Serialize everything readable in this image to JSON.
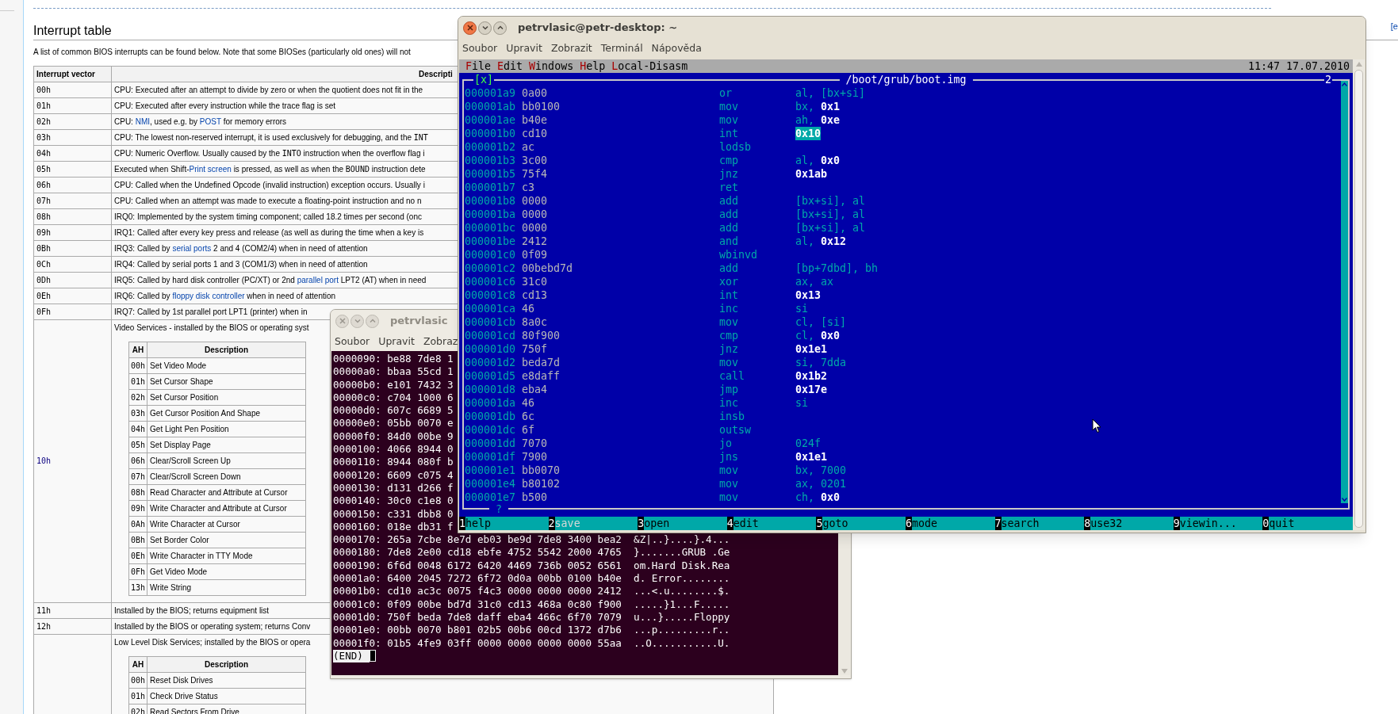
{
  "wiki": {
    "heading": "Interrupt table",
    "edit_link": "[e",
    "intro": "A list of common BIOS interrupts can be found below. Note that some BIOSes (particularly old ones) will not",
    "table": {
      "columns": [
        "Interrupt vector",
        "Descripti"
      ],
      "rows": [
        {
          "vector": {
            "kind": "text",
            "text": "00h"
          },
          "description": [
            {
              "kind": "text",
              "text": "CPU: Executed after an attempt to divide by zero or when the quotient does not fit in the"
            }
          ]
        },
        {
          "vector": {
            "kind": "text",
            "text": "01h"
          },
          "description": [
            {
              "kind": "text",
              "text": "CPU: Executed after every instruction while the trace flag is set"
            }
          ]
        },
        {
          "vector": {
            "kind": "text",
            "text": "02h"
          },
          "description": [
            {
              "kind": "text",
              "text": "CPU: "
            },
            {
              "kind": "link",
              "text": "NMI"
            },
            {
              "kind": "text",
              "text": ", used e.g. by "
            },
            {
              "kind": "link",
              "text": "POST"
            },
            {
              "kind": "text",
              "text": " for memory errors"
            }
          ]
        },
        {
          "vector": {
            "kind": "text",
            "text": "03h"
          },
          "description": [
            {
              "kind": "text",
              "text": "CPU: The lowest non-reserved interrupt, it is used exclusively for debugging, and the "
            },
            {
              "kind": "code",
              "text": "INT"
            }
          ]
        },
        {
          "vector": {
            "kind": "text",
            "text": "04h"
          },
          "description": [
            {
              "kind": "text",
              "text": "CPU: Numeric Overflow. Usually caused by the "
            },
            {
              "kind": "code",
              "text": "INTO"
            },
            {
              "kind": "text",
              "text": " instruction when the overflow flag i"
            }
          ]
        },
        {
          "vector": {
            "kind": "text",
            "text": "05h"
          },
          "description": [
            {
              "kind": "text",
              "text": "Executed when Shift-"
            },
            {
              "kind": "link",
              "text": "Print screen"
            },
            {
              "kind": "text",
              "text": " is pressed, as well as when the "
            },
            {
              "kind": "code",
              "text": "BOUND"
            },
            {
              "kind": "text",
              "text": " instruction dete"
            }
          ]
        },
        {
          "vector": {
            "kind": "text",
            "text": "06h"
          },
          "description": [
            {
              "kind": "text",
              "text": "CPU: Called when the Undefined Opcode (invalid instruction) exception occurs. Usually i"
            }
          ]
        },
        {
          "vector": {
            "kind": "text",
            "text": "07h"
          },
          "description": [
            {
              "kind": "text",
              "text": "CPU: Called when an attempt was made to execute a floating-point instruction and no n"
            }
          ]
        },
        {
          "vector": {
            "kind": "text",
            "text": "08h"
          },
          "description": [
            {
              "kind": "text",
              "text": "IRQ0: Implemented by the system timing component; called 18.2 times per second (onc"
            }
          ]
        },
        {
          "vector": {
            "kind": "text",
            "text": "09h"
          },
          "description": [
            {
              "kind": "text",
              "text": "IRQ1: Called after every key press and release (as well as during the time when a key is"
            }
          ]
        },
        {
          "vector": {
            "kind": "text",
            "text": "0Bh"
          },
          "description": [
            {
              "kind": "text",
              "text": "IRQ3: Called by "
            },
            {
              "kind": "link",
              "text": "serial ports"
            },
            {
              "kind": "text",
              "text": " 2 and 4 (COM2/4) when in need of attention"
            }
          ]
        },
        {
          "vector": {
            "kind": "text",
            "text": "0Ch"
          },
          "description": [
            {
              "kind": "text",
              "text": "IRQ4: Called by serial ports 1 and 3 (COM1/3) when in need of attention"
            }
          ]
        },
        {
          "vector": {
            "kind": "text",
            "text": "0Dh"
          },
          "description": [
            {
              "kind": "text",
              "text": "IRQ5: Called by hard disk controller (PC/XT) or 2nd "
            },
            {
              "kind": "link",
              "text": "parallel port"
            },
            {
              "kind": "text",
              "text": " LPT2 (AT) when in need"
            }
          ]
        },
        {
          "vector": {
            "kind": "text",
            "text": "0Eh"
          },
          "description": [
            {
              "kind": "text",
              "text": "IRQ6: Called by "
            },
            {
              "kind": "link",
              "text": "floppy disk controller"
            },
            {
              "kind": "text",
              "text": " when in need of attention"
            }
          ]
        },
        {
          "vector": {
            "kind": "text",
            "text": "0Fh"
          },
          "description": [
            {
              "kind": "text",
              "text": "IRQ7: Called by 1st parallel port LPT1 (printer) when in"
            }
          ]
        },
        {
          "vector": {
            "kind": "link",
            "text": "10h"
          },
          "description": [
            {
              "kind": "text",
              "text": "Video Services - installed by the BIOS or operating syst"
            }
          ],
          "subtable": {
            "columns": [
              "AH",
              "Description"
            ],
            "rows": [
              {
                "ah": "00h",
                "description": "Set Video Mode"
              },
              {
                "ah": "01h",
                "description": "Set Cursor Shape"
              },
              {
                "ah": "02h",
                "description": "Set Cursor Position"
              },
              {
                "ah": "03h",
                "description": "Get Cursor Position And Shape"
              },
              {
                "ah": "04h",
                "description": "Get Light Pen Position"
              },
              {
                "ah": "05h",
                "description": "Set Display Page"
              },
              {
                "ah": "06h",
                "description": "Clear/Scroll Screen Up"
              },
              {
                "ah": "07h",
                "description": "Clear/Scroll Screen Down"
              },
              {
                "ah": "08h",
                "description": "Read Character and Attribute at Cursor"
              },
              {
                "ah": "09h",
                "description": "Write Character and Attribute at Cursor"
              },
              {
                "ah": "0Ah",
                "description": "Write Character at Cursor"
              },
              {
                "ah": "0Bh",
                "description": "Set Border Color"
              },
              {
                "ah": "0Eh",
                "description": "Write Character in TTY Mode"
              },
              {
                "ah": "0Fh",
                "description": "Get Video Mode"
              },
              {
                "ah": "13h",
                "description": "Write String"
              }
            ]
          }
        },
        {
          "vector": {
            "kind": "text",
            "text": "11h"
          },
          "description": [
            {
              "kind": "text",
              "text": "Installed by the BIOS; returns equipment list"
            }
          ]
        },
        {
          "vector": {
            "kind": "text",
            "text": "12h"
          },
          "description": [
            {
              "kind": "text",
              "text": "Installed by the BIOS or operating system; returns Conv"
            }
          ]
        },
        {
          "description": [
            {
              "kind": "text",
              "text": "Low Level Disk Services; installed by the BIOS or opera"
            }
          ],
          "subtable": {
            "columns": [
              "AH",
              "Description"
            ],
            "rows": [
              {
                "ah": "00h",
                "description": "Reset Disk Drives"
              },
              {
                "ah": "01h",
                "description": "Check Drive Status"
              },
              {
                "ah": "02h",
                "description": "Read Sectors From Drive"
              }
            ]
          }
        }
      ]
    }
  },
  "hexdump_window": {
    "title": "petrvlasic",
    "active": false,
    "menu": [
      "Soubor",
      "Upravit",
      "Zobraz"
    ],
    "lines": [
      "0000090: be88 7de8 1",
      "00000a0: bbaa 55cd 1",
      "00000b0: e101 7432 3",
      "00000c0: c704 1000 6",
      "00000d0: 607c 6689 5",
      "00000e0: 05bb 0070 e",
      "00000f0: 84d0 00be 9",
      "0000100: 4066 8944 0",
      "0000110: 8944 080f b",
      "0000120: 6609 c075 4",
      "0000130: d131 d266 f",
      "0000140: 30c0 c1e8 0",
      "0000150: c331 dbb8 0",
      "0000160: 018e db31 f",
      "0000170: 265a 7cbe 8e7d eb03 be9d 7de8 3400 bea2  &Z|..}....}.4...",
      "0000180: 7de8 2e00 cd18 ebfe 4752 5542 2000 4765  }.......GRUB .Ge",
      "0000190: 6f6d 0048 6172 6420 4469 736b 0052 6561  om.Hard Disk.Rea",
      "00001a0: 6400 2045 7272 6f72 0d0a 00bb 0100 b40e  d. Error........",
      "00001b0: cd10 ac3c 0075 f4c3 0000 0000 0000 2412  ...<.u........$.",
      "00001c0: 0f09 00be bd7d 31c0 cd13 468a 0c80 f900  .....}1...F.....",
      "00001d0: 750f beda 7de8 daff eba4 466c 6f70 7079  u...}.....Floppy",
      "00001e0: 00bb 0070 b801 02b5 00b6 00cd 1372 d7b6  ...p.........r..",
      "00001f0: 01b5 4fe9 03ff 0000 0000 0000 0000 55aa  ..O...........U."
    ],
    "prompt": "(END)"
  },
  "disasm_window": {
    "title": "petrvlasic@petr-desktop: ~",
    "active": true,
    "menu": [
      "Soubor",
      "Upravit",
      "Zobrazit",
      "Terminál",
      "Nápověda"
    ],
    "app_menu": [
      {
        "hotkey": "F",
        "rest": "ile"
      },
      {
        "hotkey": "E",
        "rest": "dit"
      },
      {
        "hotkey": "W",
        "rest": "indows"
      },
      {
        "hotkey": "H",
        "rest": "elp"
      },
      {
        "hotkey": "L",
        "rest": "ocal-Disasm"
      }
    ],
    "clock": "11:47 17.07.2010",
    "panel": {
      "close": "[x]",
      "title": "/boot/grub/boot.img",
      "number": "2",
      "help": "?",
      "rows": [
        {
          "address": "000001a9",
          "bytes": "0a00",
          "mnemonic": "or",
          "operand": "al, [bx+si]",
          "selected": false
        },
        {
          "address": "000001ab",
          "bytes": "bb0100",
          "mnemonic": "mov",
          "operand": "bx, ",
          "imm": "0x1",
          "selected": false
        },
        {
          "address": "000001ae",
          "bytes": "b40e",
          "mnemonic": "mov",
          "operand": "ah, ",
          "imm": "0xe",
          "selected": false
        },
        {
          "address": "000001b0",
          "bytes": "cd10",
          "mnemonic": "int",
          "imm": "0x10",
          "selected": true
        },
        {
          "address": "000001b2",
          "bytes": "ac",
          "mnemonic": "lodsb",
          "selected": false
        },
        {
          "address": "000001b3",
          "bytes": "3c00",
          "mnemonic": "cmp",
          "operand": "al, ",
          "imm": "0x0",
          "selected": false
        },
        {
          "address": "000001b5",
          "bytes": "75f4",
          "mnemonic": "jnz",
          "imm": "0x1ab",
          "selected": false
        },
        {
          "address": "000001b7",
          "bytes": "c3",
          "mnemonic": "ret",
          "selected": false
        },
        {
          "address": "000001b8",
          "bytes": "0000",
          "mnemonic": "add",
          "operand": "[bx+si], al",
          "selected": false
        },
        {
          "address": "000001ba",
          "bytes": "0000",
          "mnemonic": "add",
          "operand": "[bx+si], al",
          "selected": false
        },
        {
          "address": "000001bc",
          "bytes": "0000",
          "mnemonic": "add",
          "operand": "[bx+si], al",
          "selected": false
        },
        {
          "address": "000001be",
          "bytes": "2412",
          "mnemonic": "and",
          "operand": "al, ",
          "imm": "0x12",
          "selected": false
        },
        {
          "address": "000001c0",
          "bytes": "0f09",
          "mnemonic": "wbinvd",
          "selected": false
        },
        {
          "address": "000001c2",
          "bytes": "00bebd7d",
          "mnemonic": "add",
          "operand": "[bp+7dbd], bh",
          "selected": false
        },
        {
          "address": "000001c6",
          "bytes": "31c0",
          "mnemonic": "xor",
          "operand": "ax, ax",
          "selected": false
        },
        {
          "address": "000001c8",
          "bytes": "cd13",
          "mnemonic": "int",
          "imm": "0x13",
          "selected": false
        },
        {
          "address": "000001ca",
          "bytes": "46",
          "mnemonic": "inc",
          "operand": "si",
          "selected": false
        },
        {
          "address": "000001cb",
          "bytes": "8a0c",
          "mnemonic": "mov",
          "operand": "cl, [si]",
          "selected": false
        },
        {
          "address": "000001cd",
          "bytes": "80f900",
          "mnemonic": "cmp",
          "operand": "cl, ",
          "imm": "0x0",
          "selected": false
        },
        {
          "address": "000001d0",
          "bytes": "750f",
          "mnemonic": "jnz",
          "imm": "0x1e1",
          "selected": false
        },
        {
          "address": "000001d2",
          "bytes": "beda7d",
          "mnemonic": "mov",
          "operand": "si, 7dda",
          "selected": false
        },
        {
          "address": "000001d5",
          "bytes": "e8daff",
          "mnemonic": "call",
          "imm": "0x1b2",
          "selected": false
        },
        {
          "address": "000001d8",
          "bytes": "eba4",
          "mnemonic": "jmp",
          "imm": "0x17e",
          "selected": false
        },
        {
          "address": "000001da",
          "bytes": "46",
          "mnemonic": "inc",
          "operand": "si",
          "selected": false
        },
        {
          "address": "000001db",
          "bytes": "6c",
          "mnemonic": "insb",
          "selected": false
        },
        {
          "address": "000001dc",
          "bytes": "6f",
          "mnemonic": "outsw",
          "selected": false
        },
        {
          "address": "000001dd",
          "bytes": "7070",
          "mnemonic": "jo",
          "operand": "024f",
          "selected": false
        },
        {
          "address": "000001df",
          "bytes": "7900",
          "mnemonic": "jns",
          "imm": "0x1e1",
          "selected": false
        },
        {
          "address": "000001e1",
          "bytes": "bb0070",
          "mnemonic": "mov",
          "operand": "bx, 7000",
          "selected": false
        },
        {
          "address": "000001e4",
          "bytes": "b80102",
          "mnemonic": "mov",
          "operand": "ax, 0201",
          "selected": false
        },
        {
          "address": "000001e7",
          "bytes": "b500",
          "mnemonic": "mov",
          "operand": "ch, ",
          "imm": "0x0",
          "selected": false
        }
      ]
    },
    "function_keys": [
      {
        "key": "1",
        "label": "help",
        "disabled": false
      },
      {
        "key": "2",
        "label": "save",
        "disabled": true
      },
      {
        "key": "3",
        "label": "open",
        "disabled": false
      },
      {
        "key": "4",
        "label": "edit",
        "disabled": false
      },
      {
        "key": "5",
        "label": "goto",
        "disabled": false
      },
      {
        "key": "6",
        "label": "mode",
        "disabled": false
      },
      {
        "key": "7",
        "label": "search",
        "disabled": false
      },
      {
        "key": "8",
        "label": "use32",
        "disabled": false
      },
      {
        "key": "9",
        "label": "viewin...",
        "disabled": false
      },
      {
        "key": "0",
        "label": "quit",
        "disabled": false
      }
    ]
  }
}
